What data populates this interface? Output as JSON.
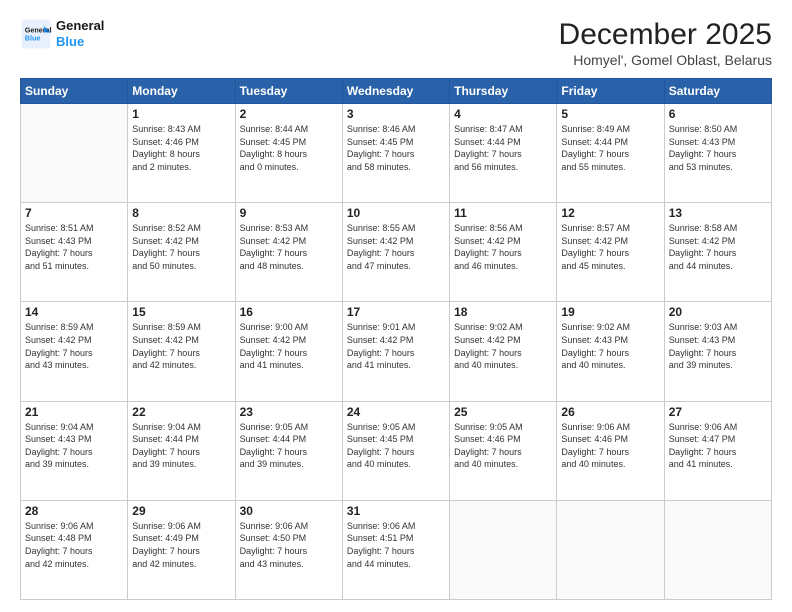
{
  "header": {
    "logo_line1": "General",
    "logo_line2": "Blue",
    "title": "December 2025",
    "subtitle": "Homyel', Gomel Oblast, Belarus"
  },
  "weekdays": [
    "Sunday",
    "Monday",
    "Tuesday",
    "Wednesday",
    "Thursday",
    "Friday",
    "Saturday"
  ],
  "weeks": [
    [
      {
        "day": "",
        "info": ""
      },
      {
        "day": "1",
        "info": "Sunrise: 8:43 AM\nSunset: 4:46 PM\nDaylight: 8 hours\nand 2 minutes."
      },
      {
        "day": "2",
        "info": "Sunrise: 8:44 AM\nSunset: 4:45 PM\nDaylight: 8 hours\nand 0 minutes."
      },
      {
        "day": "3",
        "info": "Sunrise: 8:46 AM\nSunset: 4:45 PM\nDaylight: 7 hours\nand 58 minutes."
      },
      {
        "day": "4",
        "info": "Sunrise: 8:47 AM\nSunset: 4:44 PM\nDaylight: 7 hours\nand 56 minutes."
      },
      {
        "day": "5",
        "info": "Sunrise: 8:49 AM\nSunset: 4:44 PM\nDaylight: 7 hours\nand 55 minutes."
      },
      {
        "day": "6",
        "info": "Sunrise: 8:50 AM\nSunset: 4:43 PM\nDaylight: 7 hours\nand 53 minutes."
      }
    ],
    [
      {
        "day": "7",
        "info": "Sunrise: 8:51 AM\nSunset: 4:43 PM\nDaylight: 7 hours\nand 51 minutes."
      },
      {
        "day": "8",
        "info": "Sunrise: 8:52 AM\nSunset: 4:42 PM\nDaylight: 7 hours\nand 50 minutes."
      },
      {
        "day": "9",
        "info": "Sunrise: 8:53 AM\nSunset: 4:42 PM\nDaylight: 7 hours\nand 48 minutes."
      },
      {
        "day": "10",
        "info": "Sunrise: 8:55 AM\nSunset: 4:42 PM\nDaylight: 7 hours\nand 47 minutes."
      },
      {
        "day": "11",
        "info": "Sunrise: 8:56 AM\nSunset: 4:42 PM\nDaylight: 7 hours\nand 46 minutes."
      },
      {
        "day": "12",
        "info": "Sunrise: 8:57 AM\nSunset: 4:42 PM\nDaylight: 7 hours\nand 45 minutes."
      },
      {
        "day": "13",
        "info": "Sunrise: 8:58 AM\nSunset: 4:42 PM\nDaylight: 7 hours\nand 44 minutes."
      }
    ],
    [
      {
        "day": "14",
        "info": "Sunrise: 8:59 AM\nSunset: 4:42 PM\nDaylight: 7 hours\nand 43 minutes."
      },
      {
        "day": "15",
        "info": "Sunrise: 8:59 AM\nSunset: 4:42 PM\nDaylight: 7 hours\nand 42 minutes."
      },
      {
        "day": "16",
        "info": "Sunrise: 9:00 AM\nSunset: 4:42 PM\nDaylight: 7 hours\nand 41 minutes."
      },
      {
        "day": "17",
        "info": "Sunrise: 9:01 AM\nSunset: 4:42 PM\nDaylight: 7 hours\nand 41 minutes."
      },
      {
        "day": "18",
        "info": "Sunrise: 9:02 AM\nSunset: 4:42 PM\nDaylight: 7 hours\nand 40 minutes."
      },
      {
        "day": "19",
        "info": "Sunrise: 9:02 AM\nSunset: 4:43 PM\nDaylight: 7 hours\nand 40 minutes."
      },
      {
        "day": "20",
        "info": "Sunrise: 9:03 AM\nSunset: 4:43 PM\nDaylight: 7 hours\nand 39 minutes."
      }
    ],
    [
      {
        "day": "21",
        "info": "Sunrise: 9:04 AM\nSunset: 4:43 PM\nDaylight: 7 hours\nand 39 minutes."
      },
      {
        "day": "22",
        "info": "Sunrise: 9:04 AM\nSunset: 4:44 PM\nDaylight: 7 hours\nand 39 minutes."
      },
      {
        "day": "23",
        "info": "Sunrise: 9:05 AM\nSunset: 4:44 PM\nDaylight: 7 hours\nand 39 minutes."
      },
      {
        "day": "24",
        "info": "Sunrise: 9:05 AM\nSunset: 4:45 PM\nDaylight: 7 hours\nand 40 minutes."
      },
      {
        "day": "25",
        "info": "Sunrise: 9:05 AM\nSunset: 4:46 PM\nDaylight: 7 hours\nand 40 minutes."
      },
      {
        "day": "26",
        "info": "Sunrise: 9:06 AM\nSunset: 4:46 PM\nDaylight: 7 hours\nand 40 minutes."
      },
      {
        "day": "27",
        "info": "Sunrise: 9:06 AM\nSunset: 4:47 PM\nDaylight: 7 hours\nand 41 minutes."
      }
    ],
    [
      {
        "day": "28",
        "info": "Sunrise: 9:06 AM\nSunset: 4:48 PM\nDaylight: 7 hours\nand 42 minutes."
      },
      {
        "day": "29",
        "info": "Sunrise: 9:06 AM\nSunset: 4:49 PM\nDaylight: 7 hours\nand 42 minutes."
      },
      {
        "day": "30",
        "info": "Sunrise: 9:06 AM\nSunset: 4:50 PM\nDaylight: 7 hours\nand 43 minutes."
      },
      {
        "day": "31",
        "info": "Sunrise: 9:06 AM\nSunset: 4:51 PM\nDaylight: 7 hours\nand 44 minutes."
      },
      {
        "day": "",
        "info": ""
      },
      {
        "day": "",
        "info": ""
      },
      {
        "day": "",
        "info": ""
      }
    ]
  ]
}
